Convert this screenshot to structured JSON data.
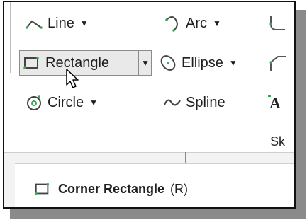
{
  "ribbon": {
    "tools": {
      "line": {
        "label": "Line",
        "arrow": "▼",
        "icon": "line-icon"
      },
      "arc": {
        "label": "Arc",
        "arrow": "▼",
        "icon": "arc-icon"
      },
      "rectangle": {
        "label": "Rectangle",
        "arrow": "▼",
        "icon": "rectangle-icon"
      },
      "ellipse": {
        "label": "Ellipse",
        "arrow": "▼",
        "icon": "ellipse-icon"
      },
      "circle": {
        "label": "Circle",
        "arrow": "▼",
        "icon": "circle-icon"
      },
      "spline": {
        "label": "Spline",
        "icon": "spline-icon"
      }
    },
    "group_label": "Sk"
  },
  "tooltip": {
    "title": "Corner Rectangle",
    "shortcut": "(R)",
    "icon": "rectangle-icon"
  },
  "colors": {
    "accent_green": "#3aa657",
    "button_fill": "#e9e9e9",
    "text": "#1f1f1f"
  }
}
